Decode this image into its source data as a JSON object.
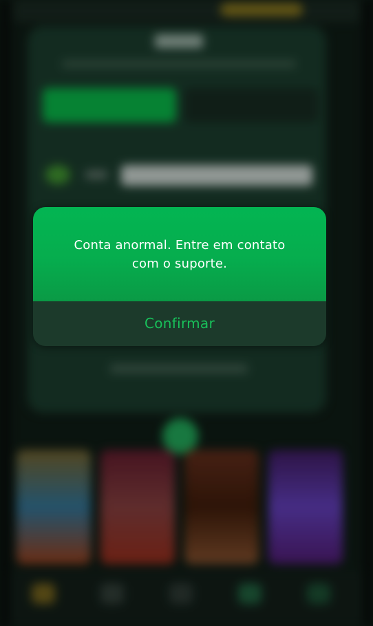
{
  "dialog": {
    "message": "Conta anormal. Entre em contato com o suporte.",
    "confirm_label": "Confirmar"
  },
  "colors": {
    "dialog_green": "#03b552",
    "footer_dark_green": "#1c3a2b",
    "confirm_text": "#18c15a",
    "message_text": "#ffffff"
  }
}
